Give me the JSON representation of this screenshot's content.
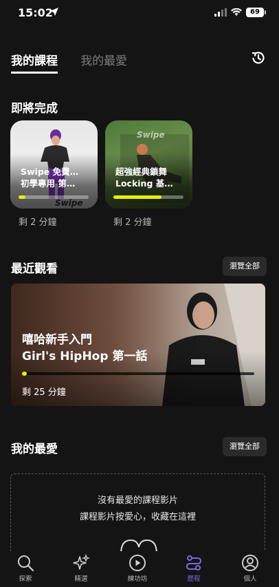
{
  "status_bar": {
    "time": "15:02",
    "battery": "69"
  },
  "tabs": [
    {
      "label": "我的課程",
      "active": true
    },
    {
      "label": "我的最愛",
      "active": false
    }
  ],
  "continue_section": {
    "title": "即將完成",
    "cards": [
      {
        "title": "Swipe 免費…\n初學專用 第…",
        "remaining": "剩 2 分鐘",
        "progress": 0.08,
        "brand": "Swipe"
      },
      {
        "title": "超強經典鎖舞\nLocking 基…",
        "remaining": "剩 2 分鐘",
        "progress": 0.55,
        "brand": "Swipe"
      }
    ]
  },
  "recent_section": {
    "title": "最近觀看",
    "browse_all": "瀏覽全部",
    "card": {
      "title_line1": "嘻哈新手入門",
      "title_line2": "Girl's HipHop 第一話",
      "remaining": "剩 25 分鐘",
      "progress": 0.02
    }
  },
  "favorites_section": {
    "title": "我的最愛",
    "browse_all": "瀏覽全部",
    "empty_line1": "沒有最愛的課程影片",
    "empty_line2": "課程影片按愛心，收藏在這裡"
  },
  "bottom_nav": [
    {
      "label": "探索",
      "icon": "search-icon"
    },
    {
      "label": "精選",
      "icon": "sparkles-icon"
    },
    {
      "label": "練功坊",
      "icon": "play-circle-icon"
    },
    {
      "label": "歷程",
      "icon": "journey-icon",
      "active": true
    },
    {
      "label": "個人",
      "icon": "user-icon"
    }
  ],
  "colors": {
    "accent": "#e6f000",
    "nav_active": "#7a6bdc",
    "background": "#141414"
  }
}
